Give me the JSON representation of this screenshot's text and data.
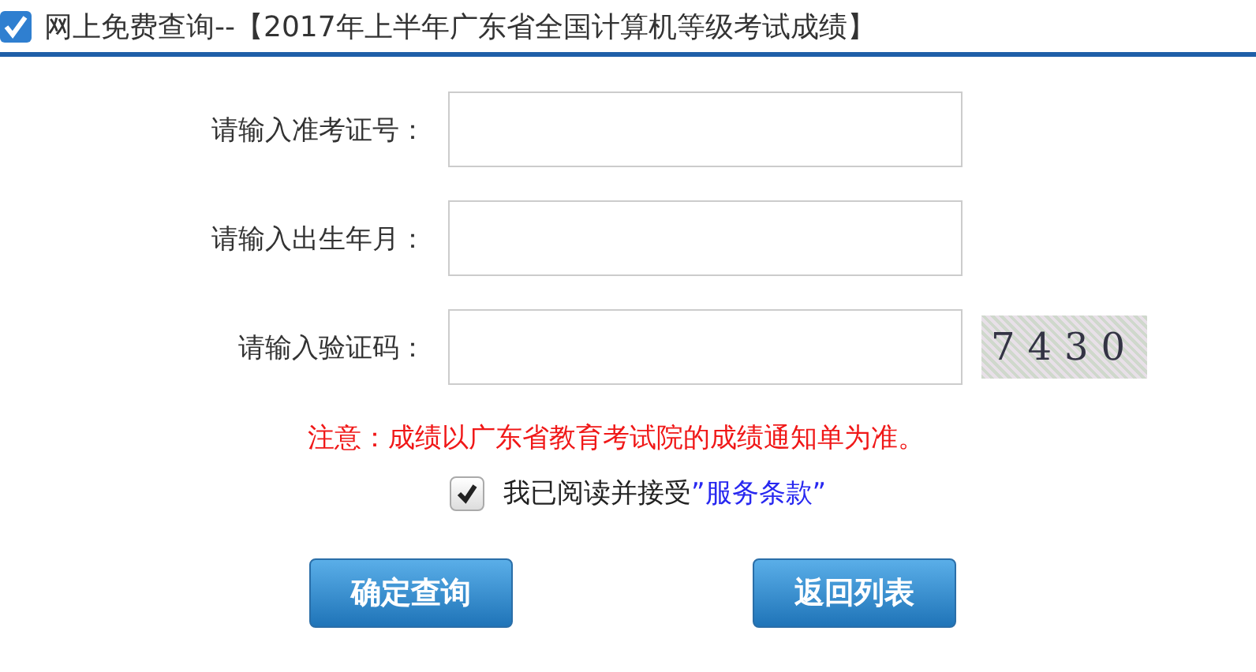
{
  "header": {
    "title": "网上免费查询--【2017年上半年广东省全国计算机等级考试成绩】"
  },
  "fields": [
    {
      "label": "请输入准考证号："
    },
    {
      "label": "请输入出生年月："
    },
    {
      "label": "请输入验证码：",
      "captcha": "7430"
    }
  ],
  "notice": "注意：成绩以广东省教育考试院的成绩通知单为准。",
  "agreement": {
    "checked": true,
    "text": "我已阅读并接受",
    "link": "”服务条款”"
  },
  "buttons": [
    "确定查询",
    "返回列表"
  ]
}
